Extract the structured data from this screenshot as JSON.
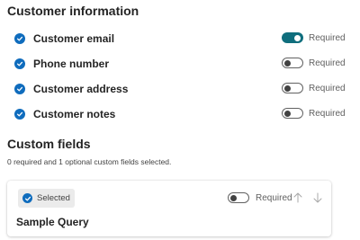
{
  "customer_info": {
    "title": "Customer information",
    "items": [
      {
        "label": "Customer email",
        "toggle_on": true,
        "required_label": "Required"
      },
      {
        "label": "Phone number",
        "toggle_on": false,
        "required_label": "Required"
      },
      {
        "label": "Customer address",
        "toggle_on": false,
        "required_label": "Required"
      },
      {
        "label": "Customer notes",
        "toggle_on": false,
        "required_label": "Required"
      }
    ]
  },
  "custom_fields": {
    "title": "Custom fields",
    "summary": "0 required and 1 optional custom fields selected.",
    "card": {
      "badge_label": "Selected",
      "name": "Sample Query",
      "toggle_on": false,
      "required_label": "Required",
      "move_up_icon": "arrow-up-icon",
      "move_down_icon": "arrow-down-icon"
    }
  },
  "colors": {
    "check_blue": "#0f6cbd",
    "toggle_on": "#0f6e7d"
  }
}
